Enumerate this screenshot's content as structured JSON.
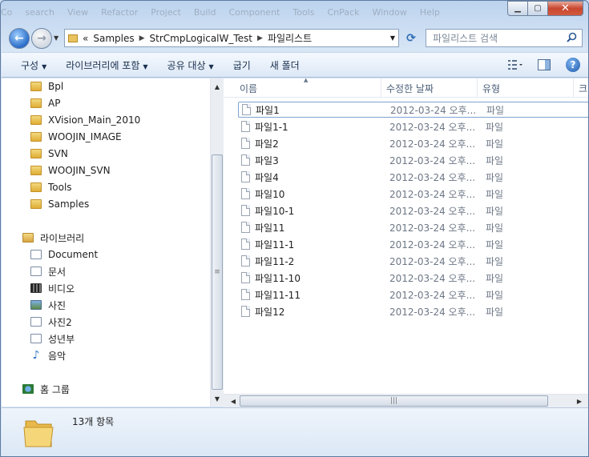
{
  "ghost_menu": [
    "Co",
    "search",
    "View",
    "Refactor",
    "Project",
    "Build",
    "Component",
    "Tools",
    "CnPack",
    "Window",
    "Help"
  ],
  "address": {
    "overflow": "«",
    "crumbs": [
      "Samples",
      "StrCmpLogicalW_Test",
      "파일리스트"
    ]
  },
  "search": {
    "placeholder": "파일리스트 검색"
  },
  "toolbar": {
    "organize": "구성",
    "include_library": "라이브러리에 포함",
    "share": "공유 대상",
    "burn": "굽기",
    "new_folder": "새 폴더"
  },
  "nav": {
    "folders": [
      "Bpl",
      "AP",
      "XVision_Main_2010",
      "WOOJIN_IMAGE",
      "SVN",
      "WOOJIN_SVN",
      "Tools",
      "Samples"
    ],
    "library_title": "라이브러리",
    "libraries": [
      {
        "label": "Document",
        "icon": "document-icon"
      },
      {
        "label": "문서",
        "icon": "document-icon"
      },
      {
        "label": "비디오",
        "icon": "video-icon"
      },
      {
        "label": "사진",
        "icon": "picture-icon"
      },
      {
        "label": "사진2",
        "icon": "document-icon"
      },
      {
        "label": "성년부",
        "icon": "document-icon"
      },
      {
        "label": "음악",
        "icon": "music-icon"
      }
    ],
    "homegroup": "홈 그룹"
  },
  "columns": {
    "name": "이름",
    "date": "수정한 날짜",
    "type": "유형",
    "more": "크"
  },
  "files": [
    {
      "name": "파일1",
      "date": "2012-03-24 오후...",
      "type": "파일"
    },
    {
      "name": "파일1-1",
      "date": "2012-03-24 오후...",
      "type": "파일"
    },
    {
      "name": "파일2",
      "date": "2012-03-24 오후...",
      "type": "파일"
    },
    {
      "name": "파일3",
      "date": "2012-03-24 오후...",
      "type": "파일"
    },
    {
      "name": "파일4",
      "date": "2012-03-24 오후...",
      "type": "파일"
    },
    {
      "name": "파일10",
      "date": "2012-03-24 오후...",
      "type": "파일"
    },
    {
      "name": "파일10-1",
      "date": "2012-03-24 오후...",
      "type": "파일"
    },
    {
      "name": "파일11",
      "date": "2012-03-24 오후...",
      "type": "파일"
    },
    {
      "name": "파일11-1",
      "date": "2012-03-24 오후...",
      "type": "파일"
    },
    {
      "name": "파일11-2",
      "date": "2012-03-24 오후...",
      "type": "파일"
    },
    {
      "name": "파일11-10",
      "date": "2012-03-24 오후...",
      "type": "파일"
    },
    {
      "name": "파일11-11",
      "date": "2012-03-24 오후...",
      "type": "파일"
    },
    {
      "name": "파일12",
      "date": "2012-03-24 오후...",
      "type": "파일"
    }
  ],
  "status": {
    "item_count": "13개 항목"
  },
  "colors": {
    "accent": "#2a6cc8",
    "close": "#c8462f",
    "toolbar_bg": "#dce8f6"
  }
}
